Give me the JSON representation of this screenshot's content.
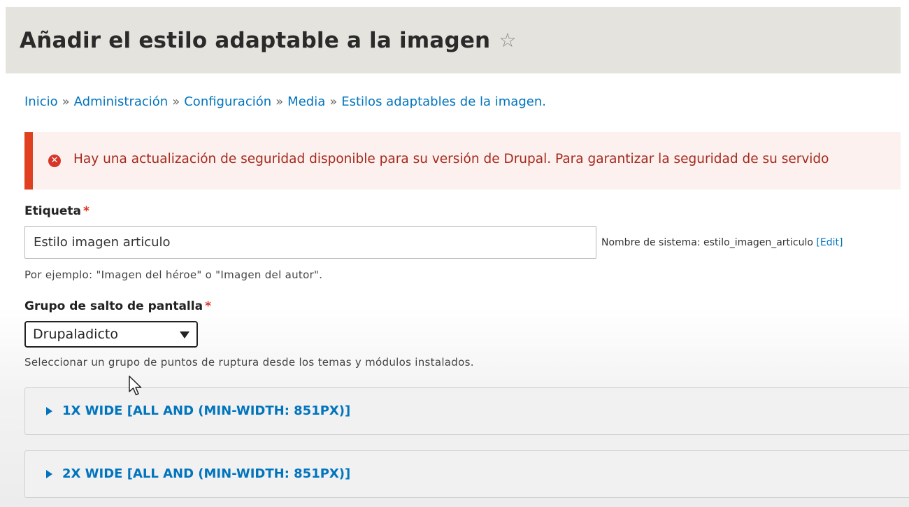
{
  "header": {
    "title": "Añadir el estilo adaptable a la imagen",
    "star_icon": "star-outline-icon"
  },
  "breadcrumb": {
    "items": [
      "Inicio",
      "Administración",
      "Configuración",
      "Media",
      "Estilos adaptables de la imagen."
    ],
    "separator": "»"
  },
  "alert": {
    "icon": "error-circle-icon",
    "text": "Hay una actualización de seguridad disponible para su versión de Drupal. Para garantizar la seguridad de su servido",
    "color": "#e0401f"
  },
  "label_field": {
    "label": "Etiqueta",
    "required_marker": "*",
    "value": "Estilo imagen articulo",
    "machine_name_prefix": "Nombre de sistema: estilo_imagen_articulo",
    "machine_name_edit": "[Edit]",
    "description": "Por ejemplo: \"Imagen del héroe\" o \"Imagen del autor\"."
  },
  "breakpoint_group": {
    "label": "Grupo de salto de pantalla",
    "required_marker": "*",
    "selected": "Drupaladicto",
    "description": "Seleccionar un grupo de puntos de ruptura desde los temas y módulos instalados."
  },
  "details": [
    {
      "summary": "1X WIDE [ALL AND (MIN-WIDTH: 851PX)]"
    },
    {
      "summary": "2X WIDE [ALL AND (MIN-WIDTH: 851PX)]"
    }
  ],
  "colors": {
    "link": "#0074bd",
    "required": "#e0301e",
    "alert_text": "#a5281d",
    "header_bg": "#e4e3dd"
  }
}
